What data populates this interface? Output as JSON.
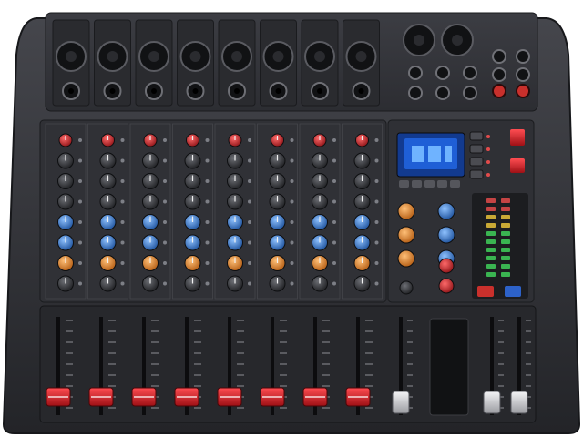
{
  "image": {
    "subject": "mixer-console",
    "channel_count": 8,
    "channel_knob_rows": [
      "red",
      "grey",
      "grey",
      "grey",
      "blue",
      "blue",
      "orange",
      "grey"
    ],
    "master_knob_colors": [
      "orange",
      "blue",
      "red"
    ],
    "fader_cap_colors": {
      "channel": "#d8262b",
      "master": "#d9dadc"
    },
    "colors": {
      "chassis": "#2b2c30",
      "panel": "#3a3b40",
      "display": "#1f5fd6",
      "led": "#3fcf5a"
    }
  }
}
